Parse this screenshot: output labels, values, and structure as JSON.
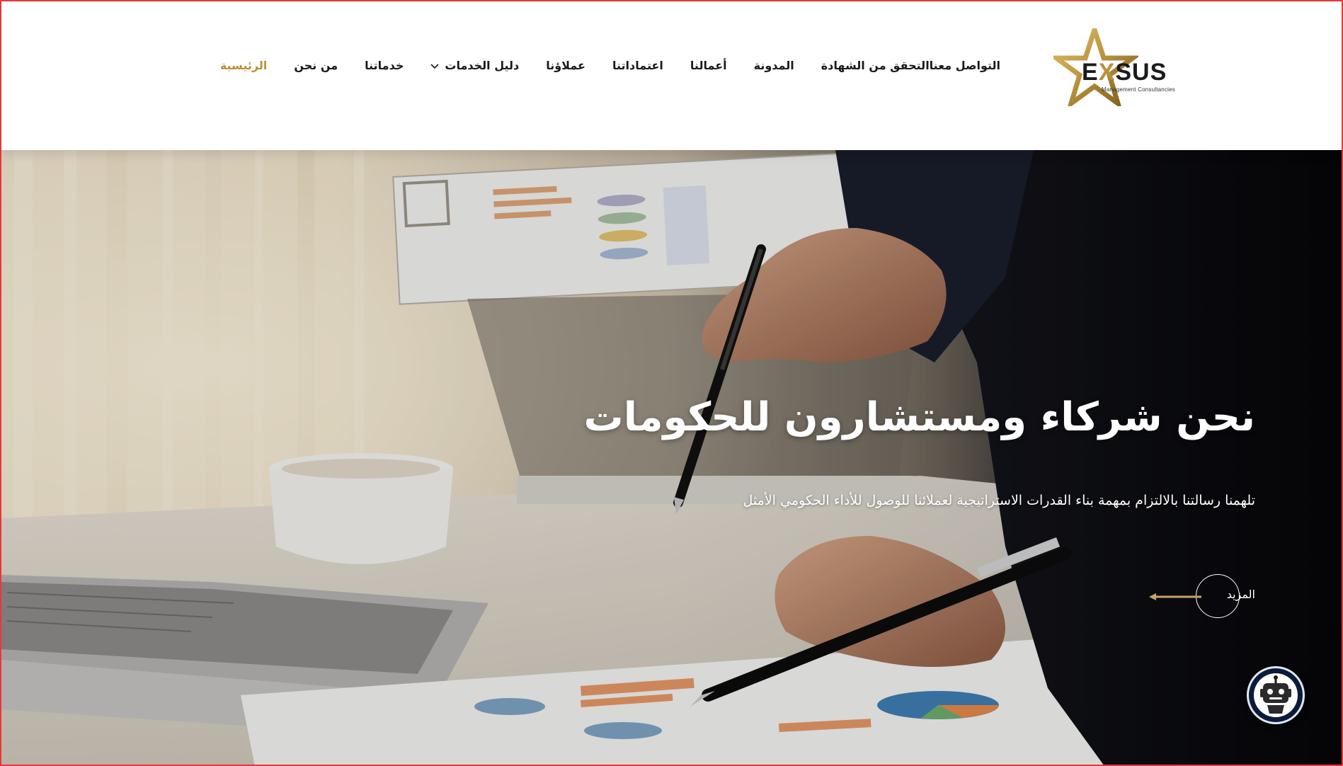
{
  "logo": {
    "word_prefix": "E",
    "word_x": "X",
    "word_suffix": "SUS",
    "subtitle": "Management Consultancies"
  },
  "nav": {
    "items": [
      {
        "label": "الرئيسية",
        "active": true
      },
      {
        "label": "من نحن"
      },
      {
        "label": "خدماتنا"
      },
      {
        "label": "دليل الخدمات",
        "has_dropdown": true
      },
      {
        "label": "عملاؤنا"
      },
      {
        "label": "اعتماداتنا"
      },
      {
        "label": "أعمالنا"
      },
      {
        "label": "المدونة"
      },
      {
        "label": "التحقق من الشهادة"
      },
      {
        "label": "التواصل معنا"
      }
    ]
  },
  "hero": {
    "title": "نحن شركاء ومستشارون للحكومات",
    "description": "تلهمنا رسالتنا بالالتزام بمهمة بناء القدرات الاستراتيجية لعملائنا للوصول للأداء الحكومي الأمثل",
    "more_label": "المزيد"
  },
  "colors": {
    "accent_gold": "#b8913c",
    "nav_text": "#1a1a1a",
    "hero_text": "#ffffff"
  },
  "icons": {
    "logo": "gold-star-icon",
    "dropdown": "chevron-down-icon",
    "more": "arrow-left-icon",
    "chat": "robot-chat-icon"
  }
}
